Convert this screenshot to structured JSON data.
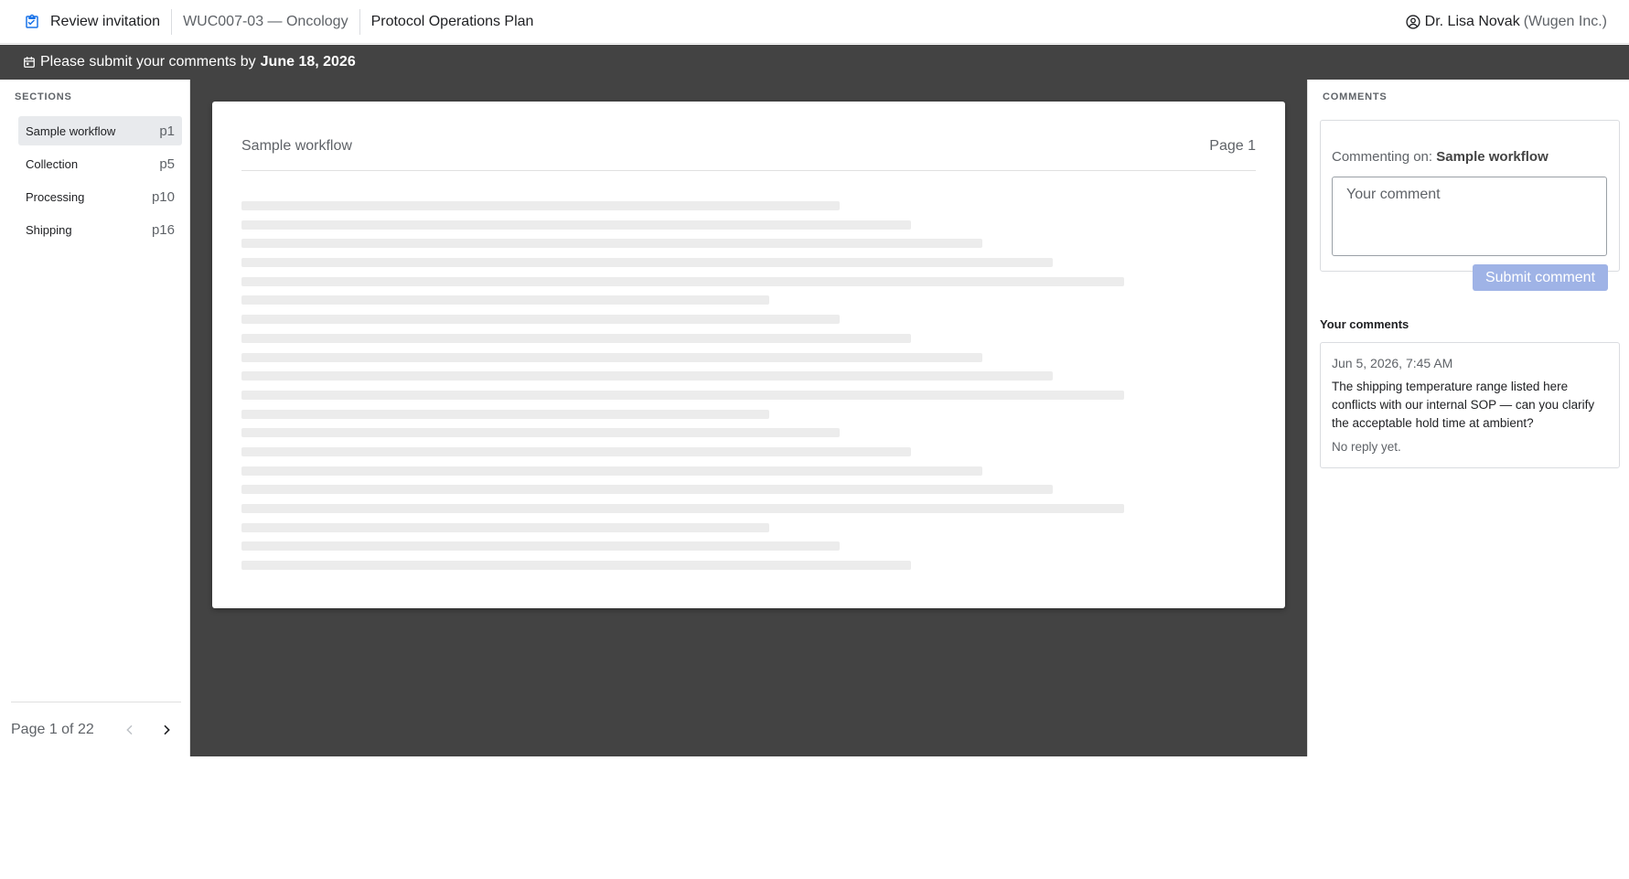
{
  "header": {
    "brand_label": "Review invitation",
    "study": "WUC007-03 — Oncology",
    "document_title": "Protocol Operations Plan",
    "user_name": "Dr. Lisa Novak",
    "user_org": "(Wugen Inc.)"
  },
  "banner": {
    "text": "Please submit your comments by",
    "date": "June 18, 2026"
  },
  "sidebar": {
    "heading": "SECTIONS",
    "items": [
      {
        "label": "Sample workflow",
        "page": "p1",
        "active": true
      },
      {
        "label": "Collection",
        "page": "p5",
        "active": false
      },
      {
        "label": "Processing",
        "page": "p10",
        "active": false
      },
      {
        "label": "Shipping",
        "page": "p16",
        "active": false
      }
    ],
    "pager_text": "Page 1 of 22"
  },
  "viewer": {
    "section_title": "Sample workflow",
    "page_label": "Page 1",
    "placeholder_line_fractions": [
      0.59,
      0.66,
      0.73,
      0.8,
      0.87,
      0.52,
      0.59,
      0.66,
      0.73,
      0.8,
      0.87,
      0.52,
      0.59,
      0.66,
      0.73,
      0.8,
      0.87,
      0.52,
      0.59,
      0.66
    ]
  },
  "comments": {
    "heading": "COMMENTS",
    "commenting_on_label": "Commenting on:",
    "commenting_on_target": "Sample workflow",
    "input_placeholder": "Your comment",
    "submit_label": "Submit comment",
    "your_comments_label": "Your comments",
    "items": [
      {
        "timestamp": "Jun 5, 2026, 7:45 AM",
        "text": "The shipping temperature range listed here conflicts with our internal SOP — can you clarify the acceptable hold time at ambient?",
        "reply_status": "No reply yet."
      }
    ]
  },
  "colors": {
    "accent": "#1a73e8",
    "viewer_background": "#434343",
    "submit_disabled": "#9fb3e6"
  }
}
